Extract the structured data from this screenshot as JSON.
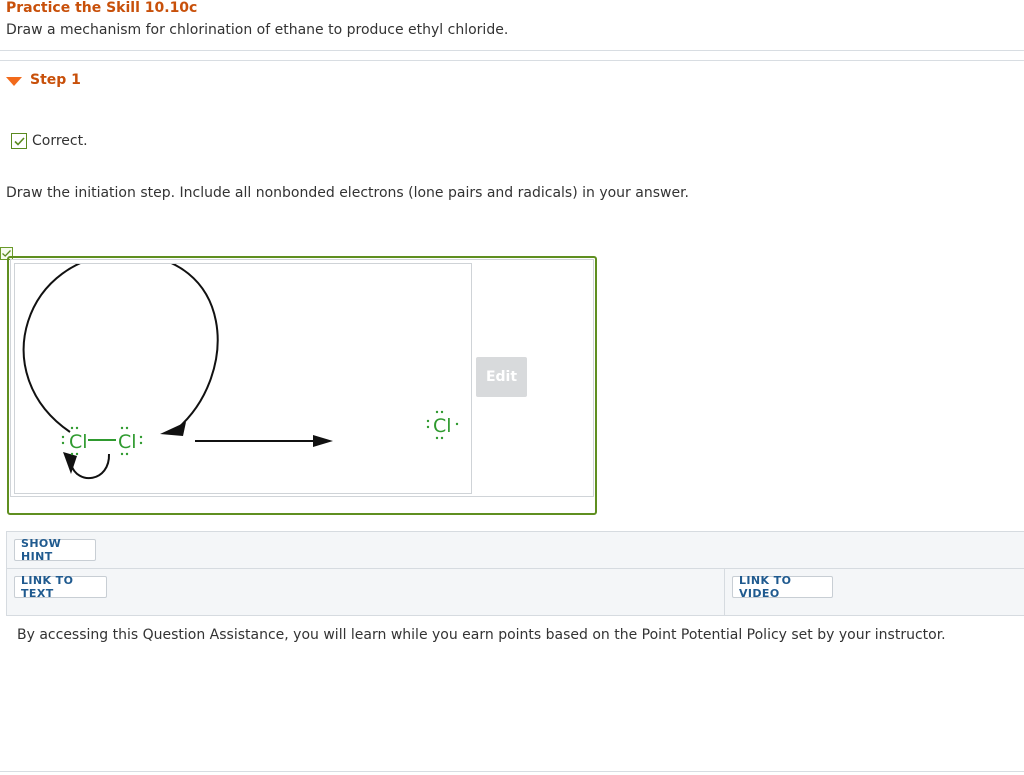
{
  "header": {
    "title": "Practice the Skill 10.10c",
    "prompt": "Draw a mechanism for chlorination of ethane to produce ethyl chloride."
  },
  "step": {
    "label": "Step 1",
    "expanded": true
  },
  "status": {
    "text": "Correct.",
    "color": "#5a8a1f"
  },
  "instruction": "Draw the initiation step. Include all nonbonded electrons (lone pairs and radicals) in your answer.",
  "answer": {
    "edit_label": "Edit",
    "molecule_left_atom": "Cl",
    "molecule_right_atom": "Cl",
    "product_atom": "Cl",
    "atom_color": "#2f9a2f",
    "frame_color": "#5f8f20"
  },
  "assistance": {
    "show_hint_label": "SHOW HINT",
    "link_text_label": "LINK TO TEXT",
    "link_video_label": "LINK TO VIDEO"
  },
  "policy_text": "By accessing this Question Assistance, you will learn while you earn points based on the Point Potential Policy set by your instructor.",
  "colors": {
    "title": "#c8500a",
    "caret": "#f26a1b",
    "link": "#1f5a8f"
  }
}
